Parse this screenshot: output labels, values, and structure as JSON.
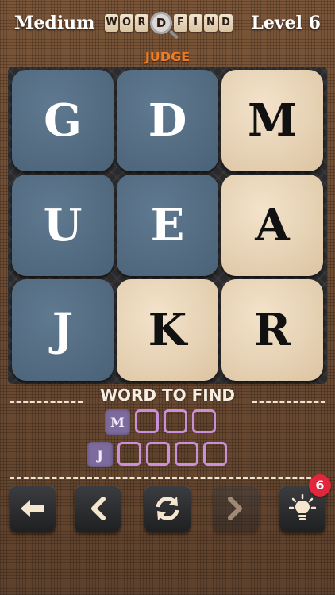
{
  "header": {
    "difficulty": "Medium",
    "level": "Level 6",
    "logo_letters": [
      "W",
      "O",
      "R",
      "D",
      "F",
      "I",
      "N",
      "D"
    ]
  },
  "category": "JUDGE",
  "grid": {
    "rows": [
      [
        {
          "letter": "G",
          "state": "used"
        },
        {
          "letter": "D",
          "state": "used"
        },
        {
          "letter": "M",
          "state": "free"
        }
      ],
      [
        {
          "letter": "U",
          "state": "used"
        },
        {
          "letter": "E",
          "state": "used"
        },
        {
          "letter": "A",
          "state": "free"
        }
      ],
      [
        {
          "letter": "J",
          "state": "used"
        },
        {
          "letter": "K",
          "state": "free"
        },
        {
          "letter": "R",
          "state": "free"
        }
      ]
    ]
  },
  "words_section": {
    "title": "WORD TO FIND",
    "words": [
      {
        "hint_letter": "M",
        "length": 4
      },
      {
        "hint_letter": "J",
        "length": 5
      }
    ]
  },
  "toolbar": {
    "buttons": [
      {
        "name": "back-button",
        "icon": "arrow-left-icon",
        "enabled": true
      },
      {
        "name": "undo-button",
        "icon": "chevron-left-icon",
        "enabled": true
      },
      {
        "name": "shuffle-button",
        "icon": "refresh-icon",
        "enabled": true
      },
      {
        "name": "next-button",
        "icon": "chevron-right-icon",
        "enabled": false
      },
      {
        "name": "hint-button",
        "icon": "lightbulb-icon",
        "enabled": true
      }
    ],
    "hint_count": "6"
  },
  "colors": {
    "used_tile": "#4a6277",
    "free_tile": "#dcc4a2",
    "category": "#f07b22",
    "slot_border": "#c98fd8",
    "hint_letter_bg": "#7d6b9d",
    "badge": "#e2263c"
  }
}
